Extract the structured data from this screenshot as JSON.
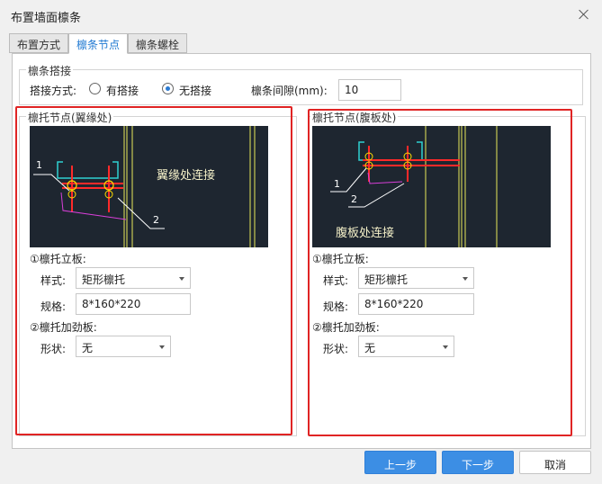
{
  "dialog": {
    "title": "布置墙面檩条"
  },
  "tabs": [
    {
      "label": "布置方式"
    },
    {
      "label": "檩条节点"
    },
    {
      "label": "檩条螺栓"
    }
  ],
  "overlap": {
    "legend": "檩条搭接",
    "mode_label": "搭接方式:",
    "option_overlap": "有搭接",
    "option_no_overlap": "无搭接",
    "selected": "无搭接",
    "gap_label": "檩条间隙(mm):",
    "gap_value": "10"
  },
  "left_panel": {
    "legend": "檩托节点(翼缘处)",
    "caption": "翼缘处连接",
    "callout_1": "1",
    "callout_2": "2",
    "section1_title": "①檩托立板:",
    "style_label": "样式:",
    "style_value": "矩形檩托",
    "spec_label": "规格:",
    "spec_value": "8*160*220",
    "section2_title": "②檩托加劲板:",
    "shape_label": "形状:",
    "shape_value": "无"
  },
  "right_panel": {
    "legend": "檩托节点(腹板处)",
    "caption": "腹板处连接",
    "callout_1": "1",
    "callout_2": "2",
    "section1_title": "①檩托立板:",
    "style_label": "样式:",
    "style_value": "矩形檩托",
    "spec_label": "规格:",
    "spec_value": "8*160*220",
    "section2_title": "②檩托加劲板:",
    "shape_label": "形状:",
    "shape_value": "无"
  },
  "buttons": {
    "prev": "上一步",
    "next": "下一步",
    "cancel": "取消"
  },
  "colors": {
    "accent": "#3c8ee4",
    "highlight": "#e02424",
    "cad_background": "#1e2630"
  }
}
